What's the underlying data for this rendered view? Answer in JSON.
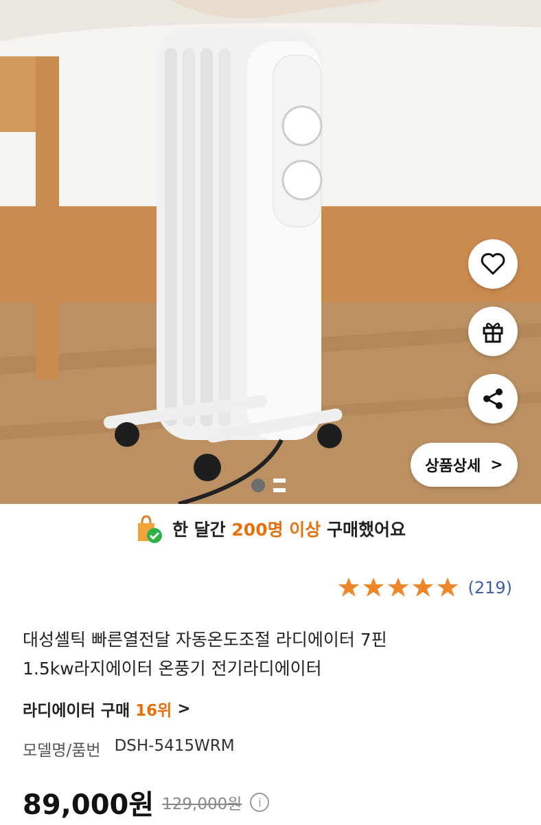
{
  "product_image": {
    "actions": {
      "wishlist_icon": "heart-icon",
      "gift_icon": "gift-icon",
      "share_icon": "share-icon"
    },
    "detail_button": {
      "label": "상품상세",
      "chevron": ">"
    },
    "pagination": {
      "active_index": 0,
      "control": "pause"
    }
  },
  "purchase_banner": {
    "prefix": "한 달간",
    "highlight": "200명 이상",
    "suffix": "구매했어요"
  },
  "rating": {
    "stars": 5,
    "count": "(219)"
  },
  "product": {
    "title_line1": "대성셀틱 빠른열전달 자동온도조절 라디에이터 7핀",
    "title_line2": "1.5kw라지에이터 온풍기 전기라디에이터",
    "rank_label": "라디에이터 구매",
    "rank_value": "16위",
    "rank_chevron": ">",
    "model_label": "모델명/품번",
    "model_value": "DSH-5415WRM",
    "price": "89,000원",
    "original_price": "129,000원"
  },
  "colors": {
    "accent": "#e8700a",
    "star": "#f0852a",
    "link": "#3c5ea8"
  }
}
